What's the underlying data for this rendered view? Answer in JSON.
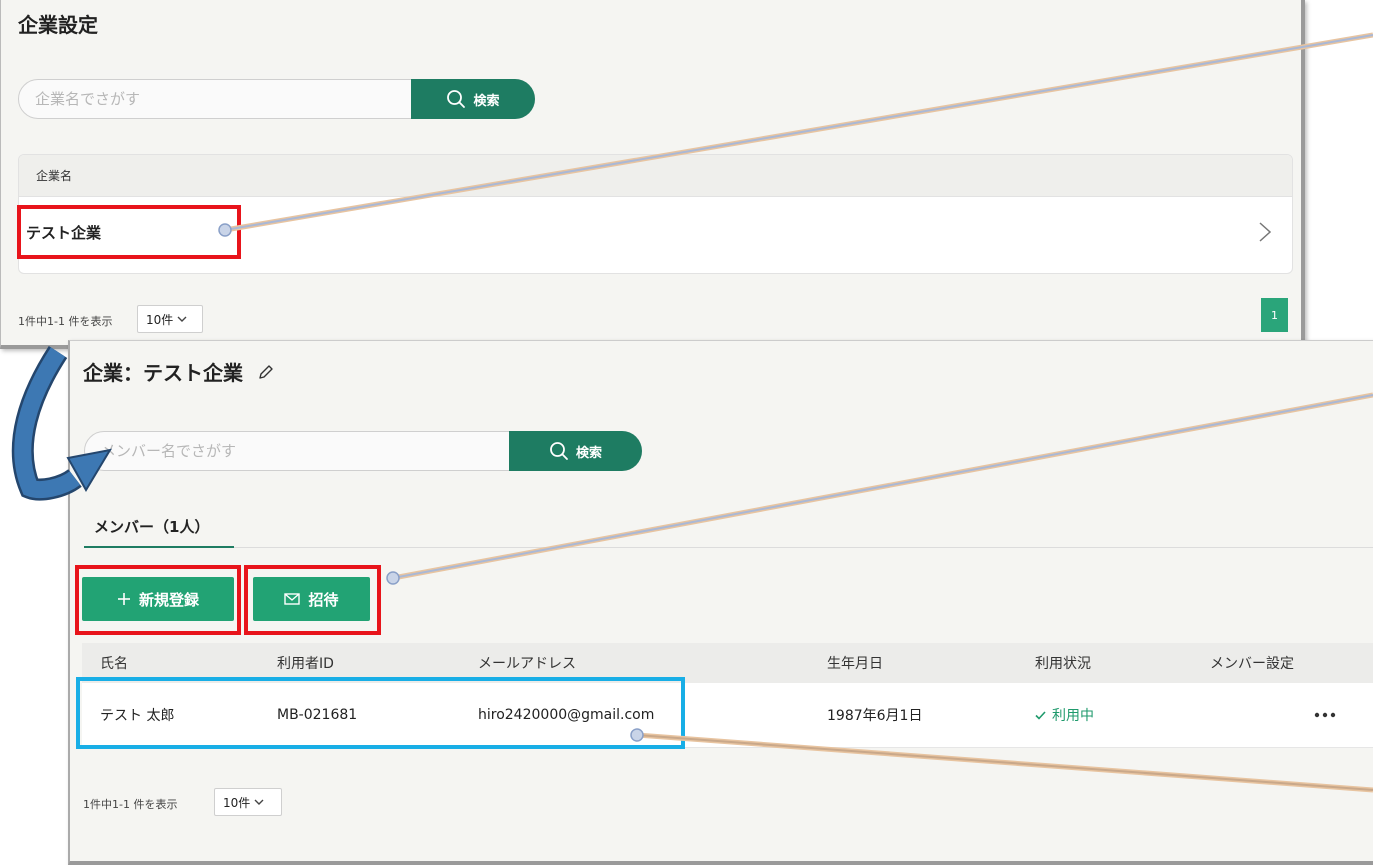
{
  "company_settings": {
    "title": "企業設定",
    "search": {
      "placeholder": "企業名でさがす",
      "button_label": "検索"
    },
    "table": {
      "header": "企業名",
      "rows": [
        {
          "name": "テスト企業"
        }
      ]
    },
    "pagination": {
      "summary": "1件中1-1 件を表示",
      "per_page": "10件",
      "current_page": "1"
    }
  },
  "company_detail": {
    "title": "企業：テスト企業",
    "search": {
      "placeholder": "メンバー名でさがす",
      "button_label": "検索"
    },
    "tab": "メンバー（1人）",
    "buttons": {
      "new_registration": "新規登録",
      "invite": "招待"
    },
    "table": {
      "columns": [
        "氏名",
        "利用者ID",
        "メールアドレス",
        "生年月日",
        "利用状況",
        "メンバー設定"
      ],
      "rows": [
        {
          "name": "テスト 太郎",
          "user_id": "MB-021681",
          "email": "hiro2420000@gmail.com",
          "birthdate": "1987年6月1日",
          "status": "利用中"
        }
      ]
    },
    "pagination": {
      "summary": "1件中1-1 件を表示",
      "per_page": "10件"
    }
  },
  "colors": {
    "primary_dark": "#1e7c62",
    "primary": "#22a374",
    "highlight_red": "#e8141b",
    "highlight_blue": "#18aee6",
    "arrow": "#3d78b3"
  },
  "icons": [
    "search-icon",
    "chevron-right-icon",
    "chevron-down-icon",
    "pencil-icon",
    "plus-icon",
    "mail-icon",
    "check-icon",
    "more-icon"
  ]
}
